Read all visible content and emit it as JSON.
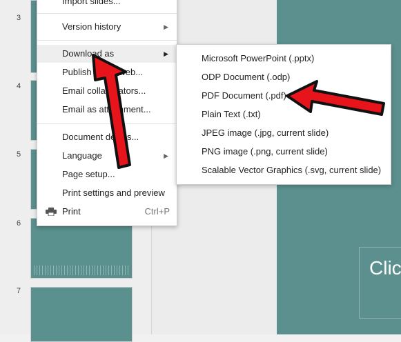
{
  "filmstrip": {
    "slides": [
      {
        "number": "3"
      },
      {
        "number": "4"
      },
      {
        "number": "5"
      },
      {
        "number": "6"
      },
      {
        "number": "7"
      }
    ],
    "thumb_color": "#5a908e"
  },
  "slide": {
    "background": "#5b908e",
    "placeholder_text": "Clic"
  },
  "file_menu": {
    "items": [
      {
        "label": "Import slides..."
      },
      {
        "label": "Version history",
        "submenu": true
      },
      {
        "label": "Download as",
        "submenu": true,
        "highlighted": true
      },
      {
        "label": "Publish to the web..."
      },
      {
        "label": "Email collaborators..."
      },
      {
        "label": "Email as attachment..."
      },
      {
        "label": "Document details..."
      },
      {
        "label": "Language",
        "submenu": true
      },
      {
        "label": "Page setup..."
      },
      {
        "label": "Print settings and preview"
      },
      {
        "label": "Print",
        "shortcut": "Ctrl+P",
        "icon": "printer-icon"
      }
    ]
  },
  "download_submenu": {
    "items": [
      {
        "label": "Microsoft PowerPoint (.pptx)"
      },
      {
        "label": "ODP Document (.odp)"
      },
      {
        "label": "PDF Document (.pdf)"
      },
      {
        "label": "Plain Text (.txt)"
      },
      {
        "label": "JPEG image (.jpg, current slide)"
      },
      {
        "label": "PNG image (.png, current slide)"
      },
      {
        "label": "Scalable Vector Graphics (.svg, current slide)"
      }
    ]
  },
  "annotation": {
    "arrow_color": "#e8141b",
    "outline_color": "#111111"
  }
}
